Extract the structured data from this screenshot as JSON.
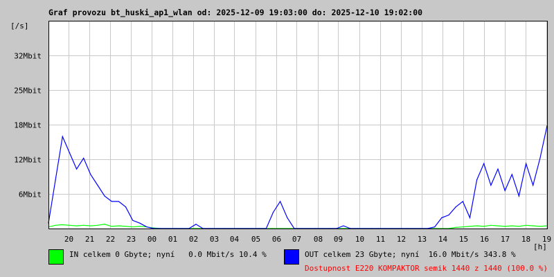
{
  "chart_data": {
    "type": "line",
    "title": "Graf provozu bt_huski_ap1_wlan od: 2025-12-09 19:03:00 do: 2025-12-10 19:02:00",
    "ylabel": "[/s]",
    "xlabel": "[h]",
    "ylim": [
      0,
      38.4
    ],
    "yticks": [
      {
        "v": 6.4,
        "label": "6Mbit"
      },
      {
        "v": 12.8,
        "label": "12Mbit"
      },
      {
        "v": 19.2,
        "label": "18Mbit"
      },
      {
        "v": 25.6,
        "label": "25Mbit"
      },
      {
        "v": 32,
        "label": "32Mbit"
      }
    ],
    "xlim_hours": [
      0,
      24
    ],
    "xticks": [
      {
        "h": 0.95,
        "label": "20"
      },
      {
        "h": 1.95,
        "label": "21"
      },
      {
        "h": 2.95,
        "label": "22"
      },
      {
        "h": 3.95,
        "label": "23"
      },
      {
        "h": 4.95,
        "label": "00"
      },
      {
        "h": 5.95,
        "label": "01"
      },
      {
        "h": 6.95,
        "label": "02"
      },
      {
        "h": 7.95,
        "label": "03"
      },
      {
        "h": 8.95,
        "label": "04"
      },
      {
        "h": 9.95,
        "label": "05"
      },
      {
        "h": 10.95,
        "label": "06"
      },
      {
        "h": 11.95,
        "label": "07"
      },
      {
        "h": 12.95,
        "label": "08"
      },
      {
        "h": 13.95,
        "label": "09"
      },
      {
        "h": 14.95,
        "label": "10"
      },
      {
        "h": 15.95,
        "label": "11"
      },
      {
        "h": 16.95,
        "label": "12"
      },
      {
        "h": 17.95,
        "label": "13"
      },
      {
        "h": 18.95,
        "label": "14"
      },
      {
        "h": 19.95,
        "label": "15"
      },
      {
        "h": 20.95,
        "label": "16"
      },
      {
        "h": 21.95,
        "label": "17"
      },
      {
        "h": 22.95,
        "label": "18"
      },
      {
        "h": 23.95,
        "label": "19"
      }
    ],
    "series": [
      {
        "name": "IN",
        "color": "#00ff00",
        "values": [
          0.3,
          0.6,
          0.7,
          0.6,
          0.5,
          0.6,
          0.5,
          0.6,
          0.8,
          0.4,
          0.5,
          0.4,
          0.3,
          0.4,
          0.3,
          0.1,
          0,
          0,
          0,
          0,
          0,
          0,
          0,
          0,
          0,
          0,
          0,
          0,
          0,
          0,
          0,
          0,
          0,
          0,
          0,
          0,
          0,
          0,
          0,
          0,
          0,
          0,
          0,
          0,
          0,
          0,
          0,
          0,
          0,
          0,
          0,
          0,
          0,
          0,
          0,
          0,
          0,
          0,
          0.2,
          0.3,
          0.4,
          0.5,
          0.4,
          0.6,
          0.5,
          0.4,
          0.5,
          0.4,
          0.6,
          0.5,
          0.4,
          0.5
        ]
      },
      {
        "name": "OUT",
        "color": "#0000ff",
        "values": [
          1,
          9,
          17,
          14,
          11,
          13,
          10,
          8,
          6,
          5,
          5,
          4,
          1.5,
          1,
          0.3,
          0,
          0,
          0,
          0,
          0,
          0,
          0.8,
          0,
          0,
          0,
          0,
          0,
          0,
          0,
          0,
          0,
          0,
          3,
          5,
          2,
          0,
          0,
          0,
          0,
          0,
          0,
          0,
          0.5,
          0,
          0,
          0,
          0,
          0,
          0,
          0,
          0,
          0,
          0,
          0,
          0,
          0.3,
          2,
          2.5,
          4,
          5,
          2,
          9,
          12,
          8,
          11,
          7,
          10,
          6,
          12,
          8,
          13,
          19
        ]
      }
    ]
  },
  "legend": {
    "in_text": "IN celkem 0 Gbyte; nyní   0.0 Mbit/s 10.4 %",
    "out_text": "OUT celkem 23 Gbyte; nyní  16.0 Mbit/s 343.8 %",
    "availability": "Dostupnost E220 KOMPAKTOR semik 1440 z 1440 (100.0 %)"
  }
}
